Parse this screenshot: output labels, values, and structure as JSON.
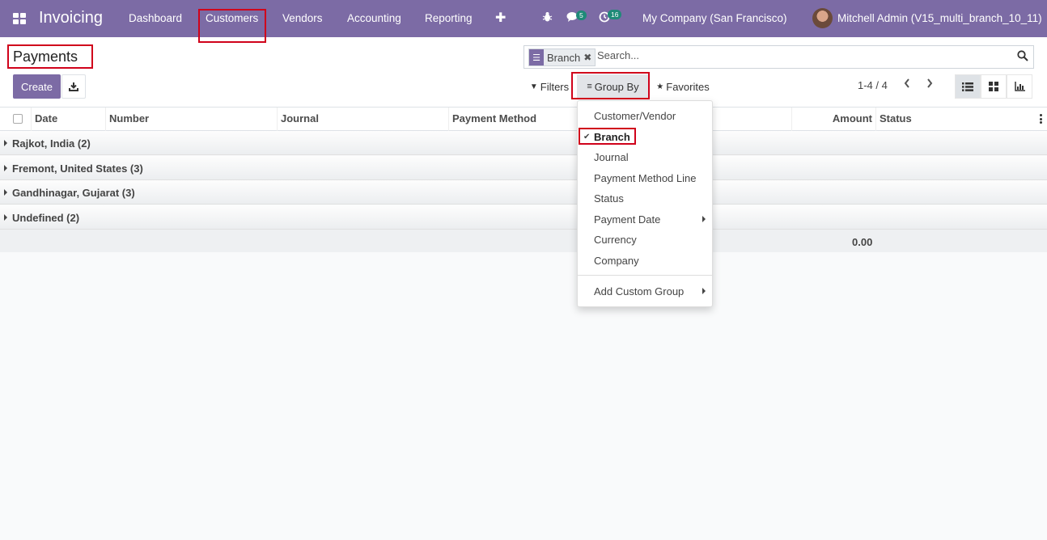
{
  "navbar": {
    "app_title": "Invoicing",
    "menu": [
      "Dashboard",
      "Customers",
      "Vendors",
      "Accounting",
      "Reporting"
    ],
    "messages_badge": "5",
    "activity_badge": "16",
    "company": "My Company (San Francisco)",
    "user": "Mitchell Admin (V15_multi_branch_10_11)"
  },
  "control": {
    "title": "Payments",
    "create_label": "Create",
    "search_facet": "Branch",
    "search_placeholder": "Search...",
    "filters_label": "Filters",
    "groupby_label": "Group By",
    "favorites_label": "Favorites",
    "pager": "1-4 / 4"
  },
  "table": {
    "columns": [
      "Date",
      "Number",
      "Journal",
      "Payment Method",
      "Amount",
      "Status"
    ],
    "groups": [
      "Rajkot, India (2)",
      "Fremont, United States (3)",
      "Gandhinagar, Gujarat (3)",
      "Undefined (2)"
    ],
    "total": "0.00"
  },
  "groupby_menu": {
    "items": [
      "Customer/Vendor",
      "Branch",
      "Journal",
      "Payment Method Line",
      "Status",
      "Payment Date",
      "Currency",
      "Company"
    ],
    "selected": "Branch",
    "custom_group": "Add Custom Group"
  },
  "colors": {
    "primary": "#7c6ba5",
    "badge": "#1f8a78",
    "highlight": "#d0021b"
  }
}
